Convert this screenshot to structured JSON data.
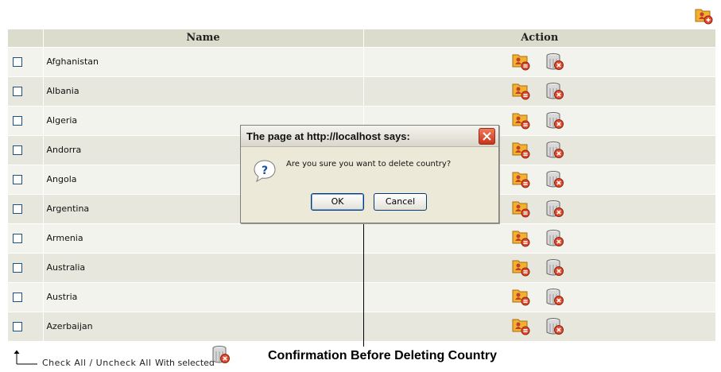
{
  "table": {
    "headers": {
      "name": "Name",
      "action": "Action"
    },
    "rows": [
      {
        "name": "Afghanistan"
      },
      {
        "name": "Albania"
      },
      {
        "name": "Algeria"
      },
      {
        "name": "Andorra"
      },
      {
        "name": "Angola"
      },
      {
        "name": "Argentina"
      },
      {
        "name": "Armenia"
      },
      {
        "name": "Australia"
      },
      {
        "name": "Austria"
      },
      {
        "name": "Azerbaijan"
      }
    ],
    "row_actions": {
      "edit_icon": "edit-country-icon",
      "delete_icon": "delete-trash-icon"
    }
  },
  "toolbar": {
    "add_icon": "add-country-icon"
  },
  "footer": {
    "check_all": "Check All / Uncheck All",
    "with_selected": "With selected",
    "bulk_delete_icon": "delete-trash-icon"
  },
  "dialog": {
    "title": "The page at http://localhost says:",
    "message": "Are you sure you want to delete country?",
    "ok_label": "OK",
    "cancel_label": "Cancel",
    "icon": "question-icon"
  },
  "annotation": {
    "caption": "Confirmation Before Deleting Country"
  },
  "colors": {
    "header_bg": "#dcdccc",
    "row_light": "#f3f3ee",
    "row_dark": "#e7e7dd",
    "dialog_bg": "#ece9d8",
    "close_red": "#c8341a"
  }
}
